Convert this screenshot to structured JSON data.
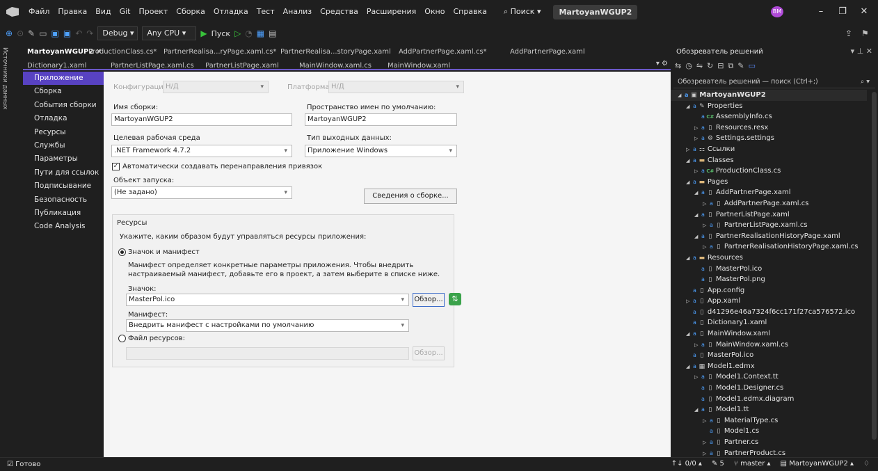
{
  "menu": {
    "items": [
      "Файл",
      "Правка",
      "Вид",
      "Git",
      "Проект",
      "Сборка",
      "Отладка",
      "Тест",
      "Анализ",
      "Средства",
      "Расширения",
      "Окно",
      "Справка"
    ],
    "search": "Поиск",
    "solution_title": "MartoyanWGUP2",
    "avatar": "BM"
  },
  "toolbar": {
    "config": "Debug",
    "platform": "Any CPU",
    "run": "Пуск"
  },
  "left_strip": "Источники данных",
  "tabs": {
    "row1": [
      {
        "label": "MartoyanWGUP2",
        "active": true
      },
      {
        "label": "ProductionClass.cs*"
      },
      {
        "label": "PartnerRealisa...ryPage.xaml.cs*"
      },
      {
        "label": "PartnerRealisa...storyPage.xaml"
      },
      {
        "label": "AddPartnerPage.xaml.cs*"
      },
      {
        "label": "AddPartnerPage.xaml"
      }
    ],
    "row2": [
      "Dictionary1.xaml",
      "PartnerListPage.xaml.cs",
      "PartnerListPage.xaml",
      "MainWindow.xaml.cs",
      "MainWindow.xaml"
    ]
  },
  "nav": {
    "items": [
      "Приложение",
      "Сборка",
      "События сборки",
      "Отладка",
      "Ресурсы",
      "Службы",
      "Параметры",
      "Пути для ссылок",
      "Подписывание",
      "Безопасность",
      "Публикация",
      "Code Analysis"
    ]
  },
  "props": {
    "config_label": "Конфигурация:",
    "config_value": "Н/Д",
    "platform_label": "Платформа:",
    "platform_value": "Н/Д",
    "assembly_label": "Имя сборки:",
    "assembly_value": "MartoyanWGUP2",
    "namespace_label": "Пространство имен по умолчанию:",
    "namespace_value": "MartoyanWGUP2",
    "framework_label": "Целевая рабочая среда",
    "framework_value": ".NET Framework 4.7.2",
    "output_label": "Тип выходных данных:",
    "output_value": "Приложение Windows",
    "autoredirect_label": "Автоматически создавать перенаправления привязок",
    "startup_label": "Объект запуска:",
    "startup_value": "(Не задано)",
    "assembly_info_button": "Сведения о сборке...",
    "resources_legend": "Ресурсы",
    "resources_desc": "Укажите, каким образом будут управляться ресурсы приложения:",
    "icon_manifest_label": "Значок и манифест",
    "manifest_note_1": "Манифест определяет конкретные параметры приложения. Чтобы внедрить",
    "manifest_note_2": "настраиваемый манифест, добавьте его в проект, а затем выберите в списке ниже.",
    "icon_label": "Значок:",
    "icon_value": "MasterPol.ico",
    "browse_button": "Обзор...",
    "manifest_label": "Манифест:",
    "manifest_value": "Внедрить манифест с настройками по умолчанию",
    "resfile_label": "Файл ресурсов:",
    "browse_button_2": "Обзор..."
  },
  "solution": {
    "header": "Обозреватель решений",
    "search": "Обозреватель решений — поиск (Ctrl+;)",
    "tree": [
      {
        "label": "MartoyanWGUP2",
        "icon": "project",
        "depth": 0,
        "glyph": "◢",
        "selected": true
      },
      {
        "label": "Properties",
        "icon": "prop",
        "depth": 1,
        "glyph": "◢"
      },
      {
        "label": "AssemblyInfo.cs",
        "icon": "cs",
        "depth": 2,
        "glyph": ""
      },
      {
        "label": "Resources.resx",
        "icon": "file",
        "depth": 2,
        "glyph": "▷"
      },
      {
        "label": "Settings.settings",
        "icon": "gear",
        "depth": 2,
        "glyph": "▷"
      },
      {
        "label": "Ссылки",
        "icon": "ref",
        "depth": 1,
        "glyph": "▷"
      },
      {
        "label": "Classes",
        "icon": "folder",
        "depth": 1,
        "glyph": "◢"
      },
      {
        "label": "ProductionClass.cs",
        "icon": "cs",
        "depth": 2,
        "glyph": "▷"
      },
      {
        "label": "Pages",
        "icon": "folder",
        "depth": 1,
        "glyph": "◢"
      },
      {
        "label": "AddPartnerPage.xaml",
        "icon": "xaml",
        "depth": 2,
        "glyph": "◢"
      },
      {
        "label": "AddPartnerPage.xaml.cs",
        "icon": "file",
        "depth": 3,
        "glyph": "▷"
      },
      {
        "label": "PartnerListPage.xaml",
        "icon": "xaml",
        "depth": 2,
        "glyph": "◢"
      },
      {
        "label": "PartnerListPage.xaml.cs",
        "icon": "file",
        "depth": 3,
        "glyph": "▷"
      },
      {
        "label": "PartnerRealisationHistoryPage.xaml",
        "icon": "xaml",
        "depth": 2,
        "glyph": "◢"
      },
      {
        "label": "PartnerRealisationHistoryPage.xaml.cs",
        "icon": "file",
        "depth": 3,
        "glyph": "▷"
      },
      {
        "label": "Resources",
        "icon": "folder",
        "depth": 1,
        "glyph": "◢"
      },
      {
        "label": "MasterPol.ico",
        "icon": "file",
        "depth": 2,
        "glyph": ""
      },
      {
        "label": "MasterPol.png",
        "icon": "file",
        "depth": 2,
        "glyph": ""
      },
      {
        "label": "App.config",
        "icon": "file",
        "depth": 1,
        "glyph": ""
      },
      {
        "label": "App.xaml",
        "icon": "xaml",
        "depth": 1,
        "glyph": "▷"
      },
      {
        "label": "d41296e46a7324f6cc171f27ca576572.ico",
        "icon": "file",
        "depth": 1,
        "glyph": ""
      },
      {
        "label": "Dictionary1.xaml",
        "icon": "xaml",
        "depth": 1,
        "glyph": ""
      },
      {
        "label": "MainWindow.xaml",
        "icon": "xaml",
        "depth": 1,
        "glyph": "◢"
      },
      {
        "label": "MainWindow.xaml.cs",
        "icon": "file",
        "depth": 2,
        "glyph": "▷"
      },
      {
        "label": "MasterPol.ico",
        "icon": "file",
        "depth": 1,
        "glyph": ""
      },
      {
        "label": "Model1.edmx",
        "icon": "edmx",
        "depth": 1,
        "glyph": "◢"
      },
      {
        "label": "Model1.Context.tt",
        "icon": "file",
        "depth": 2,
        "glyph": "▷"
      },
      {
        "label": "Model1.Designer.cs",
        "icon": "file",
        "depth": 2,
        "glyph": ""
      },
      {
        "label": "Model1.edmx.diagram",
        "icon": "file",
        "depth": 2,
        "glyph": ""
      },
      {
        "label": "Model1.tt",
        "icon": "file",
        "depth": 2,
        "glyph": "◢"
      },
      {
        "label": "MaterialType.cs",
        "icon": "file",
        "depth": 3,
        "glyph": "▷"
      },
      {
        "label": "Model1.cs",
        "icon": "file",
        "depth": 3,
        "glyph": ""
      },
      {
        "label": "Partner.cs",
        "icon": "file",
        "depth": 3,
        "glyph": "▷"
      },
      {
        "label": "PartnerProduct.cs",
        "icon": "file",
        "depth": 3,
        "glyph": "▷"
      }
    ]
  },
  "status": {
    "left": "Готово",
    "counter": "↑↓ 0/0 ▴",
    "pencil": "5",
    "branch": "master ▴",
    "repo": "MartoyanWGUP2 ▴"
  }
}
